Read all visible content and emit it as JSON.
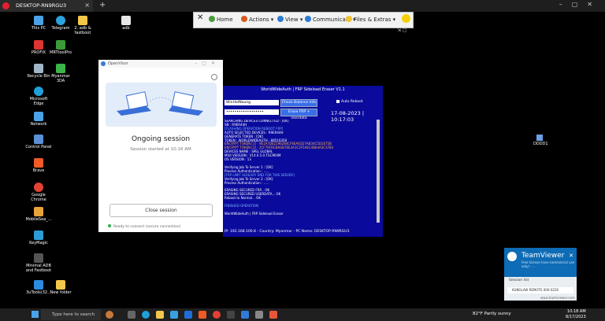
{
  "browser": {
    "tab_title": "DESKTOP-RN9RGU3",
    "new_tab": "+"
  },
  "tv_toolbar": {
    "home": "Home",
    "actions": "Actions",
    "view": "View",
    "communicate": "Communicate",
    "files": "Files & Extras"
  },
  "desktop_icons": [
    "This PC",
    "Telegram",
    "2. adb & fastboot",
    "adb",
    "PROFIX",
    "MRTtoolPro",
    "Recycle Bin",
    "Myanmar 3DA",
    "Microsoft Edge",
    "Network",
    "Control Panel",
    "Brave",
    "Google Chrome",
    "MobileSea_...",
    "KeyMagic",
    "Minimal ADB and Fastboot",
    "3uTools(32...",
    "New folder"
  ],
  "openvisor": {
    "app_name": "OpenVisor",
    "heading": "Ongoing session",
    "subtext": "Session started at 10:16 AM",
    "close_button": "Close session",
    "status": "Ready to connect (secure connection)"
  },
  "frp_tool": {
    "title": "WorldWideAuth | FRP Sideload Eraser V1.1",
    "username": "WinHotNaung",
    "password": "••••••••••••••••••",
    "check_balance": "Check Balance Info",
    "erase_button": "Erase FRP + Userdata",
    "auto_reboot": "Auto Reboot",
    "datetime": "17-08-2023 | 10:17:03",
    "log": [
      "SEARCHING DEVICES CONNECTED : [OK]",
      "SN : R9ER44H",
      "[FLASHING OPERATION REBOOT FRP]",
      "AUTO SELECTED DEVICES : R9ER44H",
      "GENERATE TOKEN : [OK]",
      "TOKEN : WORLDWIDEAUTH - 88510358",
      "ENCRYPT TOKEN [1] : 9E1A7D62196284CF6EA61D7AB34C5D1E75B",
      "ENCRYPT TOKEN [2] : 2CF79FDCBA0D7EE3A1C2F5AEC4B64A3C1FB3",
      "DEVICES NAME : SPEL GLOBAL",
      "MIUI VERSION : V14.0.5.0.TGCMIXM",
      "OS VERSION : 13",
      "",
      "Verifying Job To Server 1 : [OK]",
      "Process Authentication : .....",
      "[FRP LIMIT ALREADY END FOR THIS SERVER]",
      "Verifying Job To Server 2 : [OK]",
      "Process Authentication : .....",
      "",
      "ERASING SECURED FRP... OK",
      "ERASING SECURED USERDATA... OK",
      "Reboot to Normal... OK",
      "",
      "FINISHED OPERATION",
      "",
      "WorldWideAuth | FRP Sideload Eraser"
    ],
    "footer": "IP: 192.168.100.8 - Country: Myanmar - PC Name: DESKTOP-RN9RGU3"
  },
  "teamviewer": {
    "brand": "TeamViewer",
    "free": "Free license (non-commercial use only) - ...",
    "session_label": "Session list",
    "session_row": "KUNGLAW REMOTE 000-0226",
    "url": "www.teamviewer.com"
  },
  "right_icon": "DDDD1",
  "taskbar": {
    "search_placeholder": "Type here to search",
    "weather": "82°F  Partly sunny",
    "time": "10:18 AM",
    "date": "8/17/2023"
  }
}
